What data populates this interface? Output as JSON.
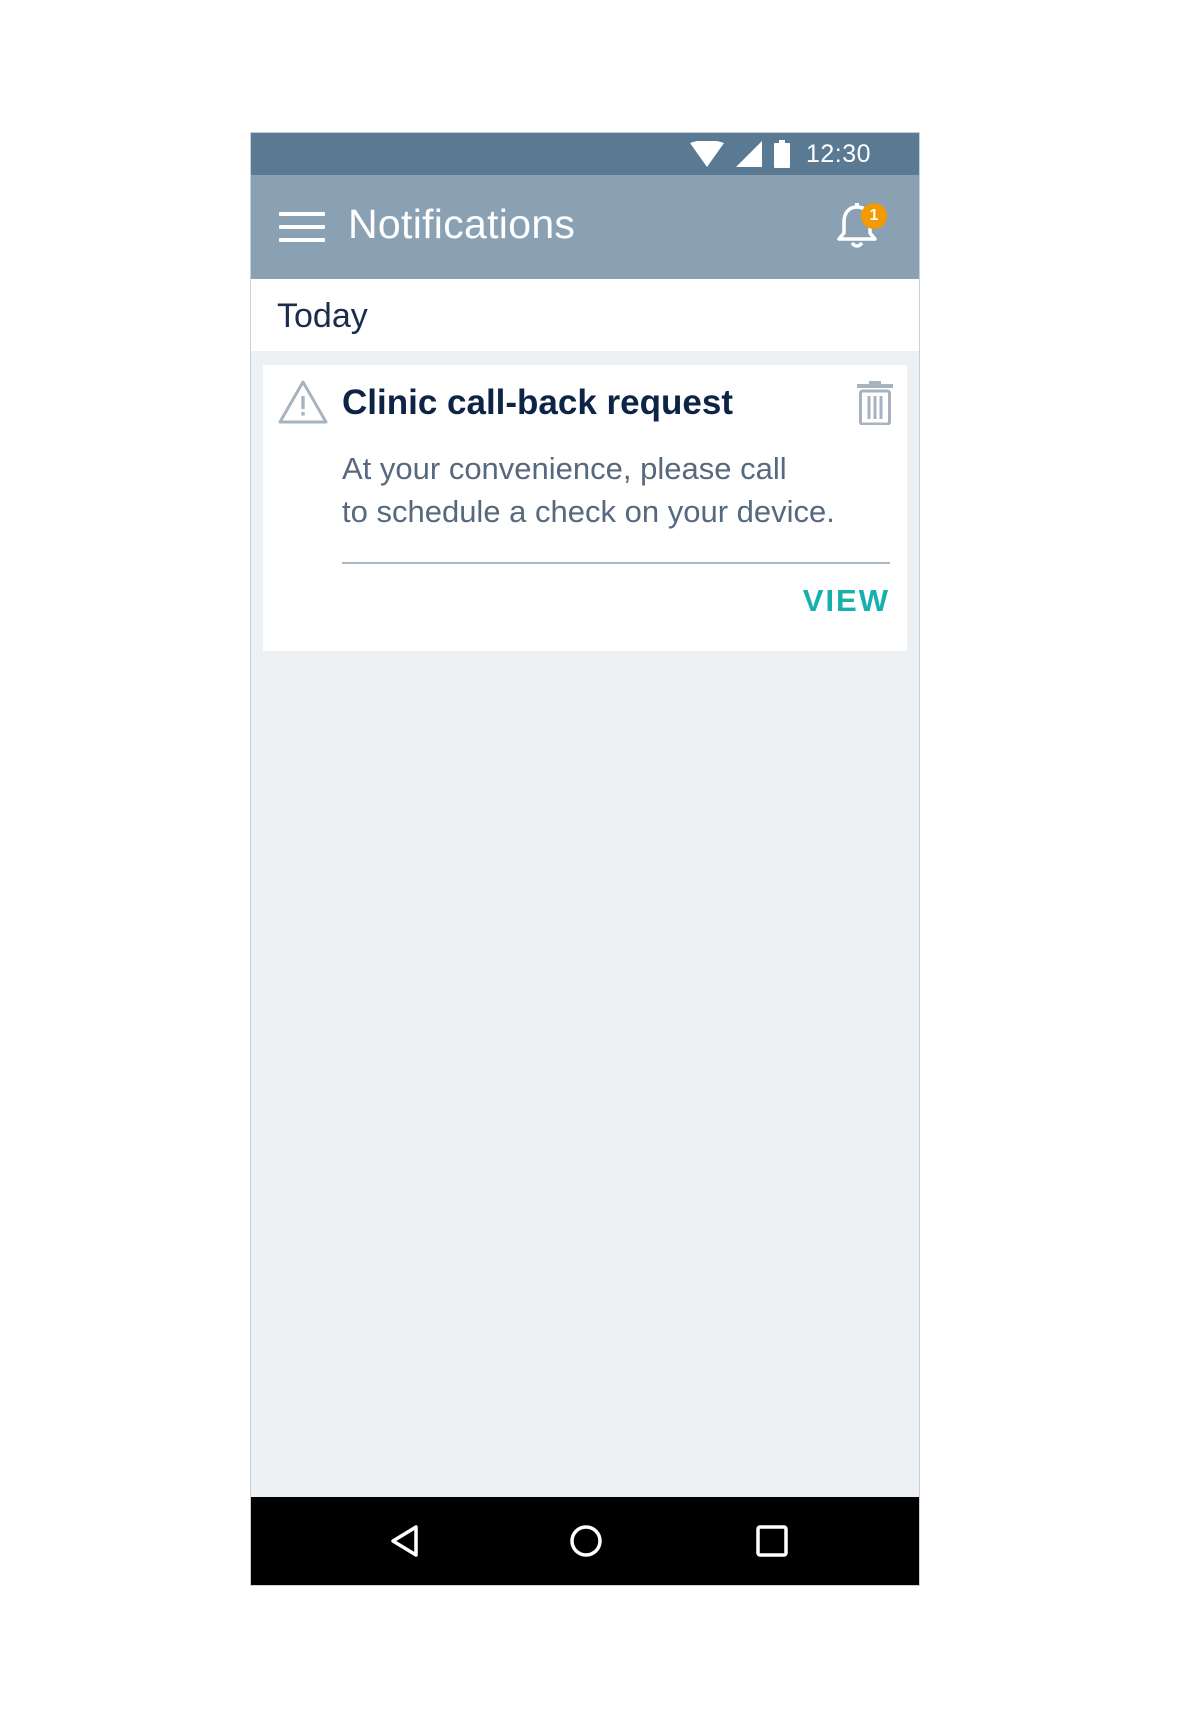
{
  "status_bar": {
    "time": "12:30",
    "icons": [
      "wifi-icon",
      "cell-signal-icon",
      "battery-icon"
    ]
  },
  "app_bar": {
    "title": "Notifications",
    "menu_icon": "hamburger-menu-icon",
    "bell_icon": "notification-bell-icon",
    "badge_count": "1"
  },
  "section": {
    "label": "Today"
  },
  "notification": {
    "icon": "warning-triangle-icon",
    "title": "Clinic call-back request",
    "body_line_1": "At your convenience, please call",
    "body_line_2": "to schedule a check on your device.",
    "action_label": "VIEW",
    "delete_icon": "trash-icon"
  },
  "nav_bar": {
    "buttons": [
      "back-icon",
      "home-icon",
      "recents-icon"
    ]
  },
  "colors": {
    "status_bar": "#5a7a93",
    "app_bar": "#8aa1b4",
    "badge": "#f29a00",
    "accent": "#16b0ad",
    "title_text": "#0e2446",
    "body_text": "#56697e",
    "background": "#edf1f4"
  }
}
